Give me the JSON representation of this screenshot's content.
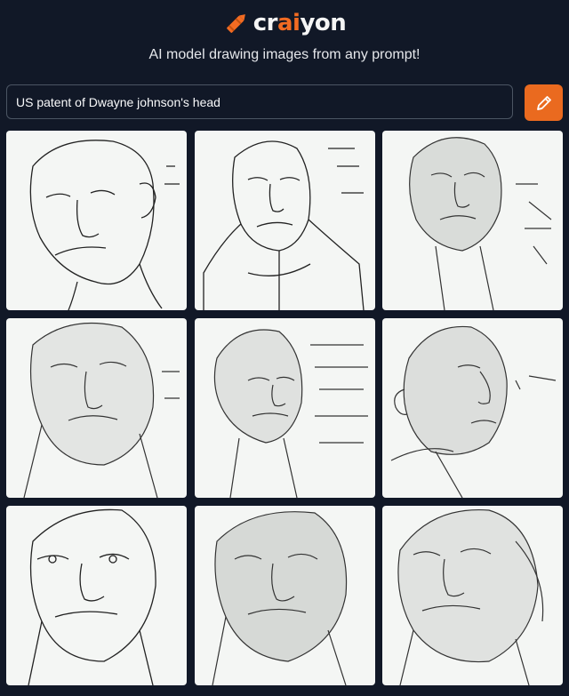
{
  "brand": {
    "name_part1": "cr",
    "name_accent": "ai",
    "name_part2": "yon",
    "logo_icon": "crayon-icon",
    "accent_color": "#f26b22"
  },
  "tagline": "AI model drawing images from any prompt!",
  "prompt": {
    "value": "US patent of Dwayne johnson's head"
  },
  "draw_button": {
    "icon": "pencil-icon",
    "color": "#ea6a1f"
  },
  "results": [
    {
      "pose": "tilted-up-left",
      "style": "line-drawing"
    },
    {
      "pose": "front-with-collar",
      "style": "line-drawing"
    },
    {
      "pose": "three-quarter-right",
      "style": "shaded-sketch"
    },
    {
      "pose": "front-wide",
      "style": "shaded-sketch"
    },
    {
      "pose": "three-quarter-left",
      "style": "shaded-sketch"
    },
    {
      "pose": "profile-right",
      "style": "shaded-sketch"
    },
    {
      "pose": "front-close",
      "style": "line-drawing"
    },
    {
      "pose": "front-shaded",
      "style": "shaded-sketch"
    },
    {
      "pose": "front-right-shaded",
      "style": "shaded-sketch"
    }
  ]
}
